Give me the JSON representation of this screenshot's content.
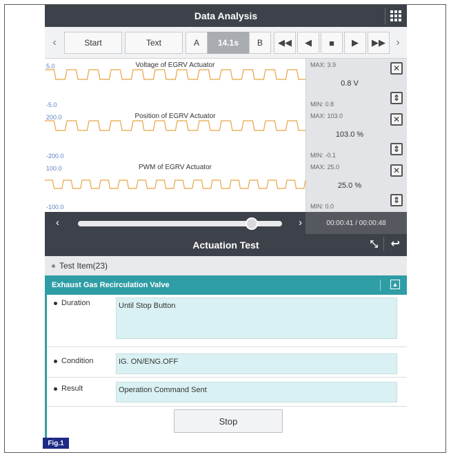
{
  "header": {
    "title": "Data Analysis",
    "menu_icon": "grid-menu-icon"
  },
  "toolbar": {
    "start_label": "Start",
    "text_label": "Text",
    "a_label": "A",
    "time_label": "14.1s",
    "b_label": "B",
    "icons": [
      "chevron-left-icon",
      "rewind-icon",
      "step-back-icon",
      "stop-icon",
      "play-icon",
      "fast-forward-icon",
      "chevron-right-icon"
    ]
  },
  "graphs": [
    {
      "title": "Voltage of EGRV Actuator",
      "ymax": "5.0",
      "ymin": "-5.0",
      "max": "MAX: 3.9",
      "current": "0.8 V",
      "min": "MIN: 0.8",
      "color": "#e8a341"
    },
    {
      "title": "Position of EGRV Actuator",
      "ymax": "200.0",
      "ymin": "-200.0",
      "max": "MAX: 103.0",
      "current": "103.0 %",
      "min": "MIN: -0.1",
      "color": "#e8a341"
    },
    {
      "title": "PWM of EGRV Actuator",
      "ymax": "100.0",
      "ymin": "-100.0",
      "max": "MAX: 25.0",
      "current": "25.0 %",
      "min": "MIN: 0.0",
      "color": "#e8a341"
    }
  ],
  "playback": {
    "time": "00:00:41 / 00:00:48",
    "progress": 0.85
  },
  "actuation": {
    "title": "Actuation Test",
    "test_item": "Test Item(23)",
    "section_title": "Exhaust Gas Recirculation Valve",
    "rows": [
      {
        "label": "Duration",
        "value": "Until Stop Button"
      },
      {
        "label": "Condition",
        "value": "IG. ON/ENG.OFF"
      },
      {
        "label": "Result",
        "value": "Operation Command Sent"
      }
    ],
    "stop_label": "Stop"
  },
  "figure_label": "Fig.1"
}
